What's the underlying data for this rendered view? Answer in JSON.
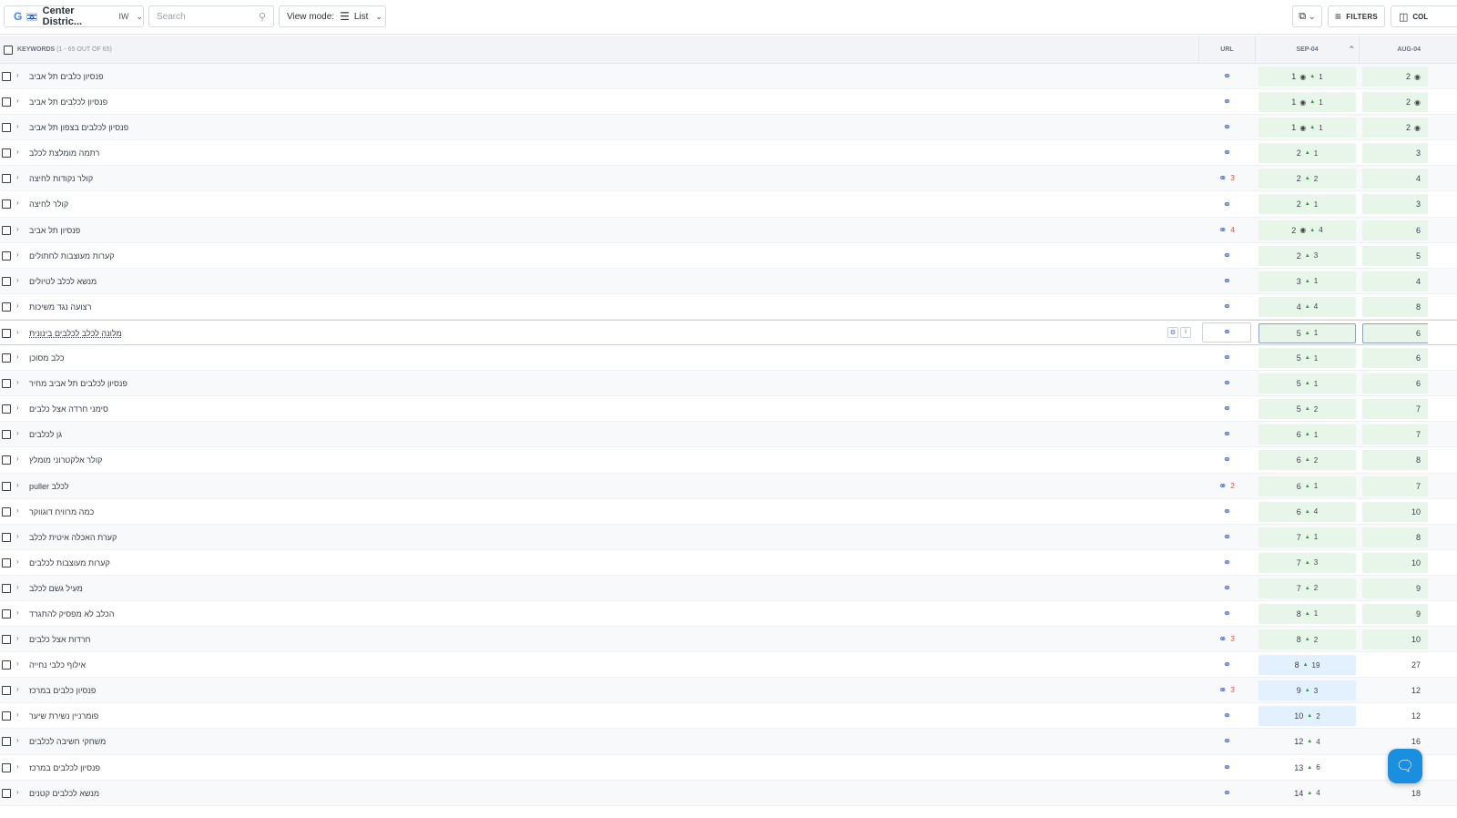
{
  "toolbar": {
    "location": {
      "engine_icon": "google-icon",
      "flag_icon": "israel-flag-icon",
      "name": "Center Distric...",
      "lang": "IW"
    },
    "search_placeholder": "Search",
    "view_mode": {
      "label": "View mode:",
      "value": "List",
      "icon": "list-icon"
    },
    "copy_icon": "copy-icon",
    "filters_label": "FILTERS",
    "columns_label": "COL"
  },
  "table": {
    "header": {
      "keywords": "KEYWORDS",
      "count": "(1 - 65 OUT OF 65)",
      "url": "URL",
      "col1": "SEP-04",
      "col2": "AUG-04"
    },
    "colors": {
      "green": "#e8f6ea",
      "blue": "#e2f1fd",
      "link": "#3f6ad8",
      "up": "#2f9a46",
      "url_count": "#e05050"
    },
    "rows": [
      {
        "kw": "פנסיון כלבים תל אביב",
        "urls": "",
        "pos": "1",
        "pin": true,
        "delta": "1",
        "prev": "2",
        "prev_pin": true,
        "style": "green"
      },
      {
        "kw": "פנסיון לכלבים תל אביב",
        "urls": "",
        "pos": "1",
        "pin": true,
        "delta": "1",
        "prev": "2",
        "prev_pin": true,
        "style": "green"
      },
      {
        "kw": "פנסיון לכלבים בצפון תל אביב",
        "urls": "",
        "pos": "1",
        "pin": true,
        "delta": "1",
        "prev": "2",
        "prev_pin": true,
        "style": "green"
      },
      {
        "kw": "רתמה מומלצת לכלב",
        "urls": "",
        "pos": "2",
        "pin": false,
        "delta": "1",
        "prev": "3",
        "prev_pin": false,
        "style": "green"
      },
      {
        "kw": "קולר נקודות לחיצה",
        "urls": "3",
        "pos": "2",
        "pin": false,
        "delta": "2",
        "prev": "4",
        "prev_pin": false,
        "style": "green"
      },
      {
        "kw": "קולר לחיצה",
        "urls": "",
        "pos": "2",
        "pin": false,
        "delta": "1",
        "prev": "3",
        "prev_pin": false,
        "style": "green"
      },
      {
        "kw": "פנסיון תל אביב",
        "urls": "4",
        "pos": "2",
        "pin": true,
        "delta": "4",
        "prev": "6",
        "prev_pin": false,
        "style": "green"
      },
      {
        "kw": "קערות מעוצבות לחתולים",
        "urls": "",
        "pos": "2",
        "pin": false,
        "delta": "3",
        "prev": "5",
        "prev_pin": false,
        "style": "green"
      },
      {
        "kw": "מנשא לכלב לטיולים",
        "urls": "",
        "pos": "3",
        "pin": false,
        "delta": "1",
        "prev": "4",
        "prev_pin": false,
        "style": "green"
      },
      {
        "kw": "רצועה נגד משיכות",
        "urls": "",
        "pos": "4",
        "pin": false,
        "delta": "4",
        "prev": "8",
        "prev_pin": false,
        "style": "green"
      },
      {
        "kw": "מלונה לכלב לכלבים בינונית",
        "urls": "",
        "pos": "5",
        "pin": false,
        "delta": "1",
        "prev": "6",
        "prev_pin": false,
        "style": "green",
        "selected": true
      },
      {
        "kw": "כלב מסוכן",
        "urls": "",
        "pos": "5",
        "pin": false,
        "delta": "1",
        "prev": "6",
        "prev_pin": false,
        "style": "green"
      },
      {
        "kw": "פנסיון לכלבים תל אביב מחיר",
        "urls": "",
        "pos": "5",
        "pin": false,
        "delta": "1",
        "prev": "6",
        "prev_pin": false,
        "style": "green"
      },
      {
        "kw": "סימני חרדה אצל כלבים",
        "urls": "",
        "pos": "5",
        "pin": false,
        "delta": "2",
        "prev": "7",
        "prev_pin": false,
        "style": "green"
      },
      {
        "kw": "גן לכלבים",
        "urls": "",
        "pos": "6",
        "pin": false,
        "delta": "1",
        "prev": "7",
        "prev_pin": false,
        "style": "green"
      },
      {
        "kw": "קולר אלקטרוני מומלץ",
        "urls": "",
        "pos": "6",
        "pin": false,
        "delta": "2",
        "prev": "8",
        "prev_pin": false,
        "style": "green"
      },
      {
        "kw": "puller לכלב",
        "urls": "2",
        "pos": "6",
        "pin": false,
        "delta": "1",
        "prev": "7",
        "prev_pin": false,
        "style": "green"
      },
      {
        "kw": "כמה מרוויח דוגווקר",
        "urls": "",
        "pos": "6",
        "pin": false,
        "delta": "4",
        "prev": "10",
        "prev_pin": false,
        "style": "green"
      },
      {
        "kw": "קערת האכלה איטית לכלב",
        "urls": "",
        "pos": "7",
        "pin": false,
        "delta": "1",
        "prev": "8",
        "prev_pin": false,
        "style": "green"
      },
      {
        "kw": "קערות מעוצבות לכלבים",
        "urls": "",
        "pos": "7",
        "pin": false,
        "delta": "3",
        "prev": "10",
        "prev_pin": false,
        "style": "green"
      },
      {
        "kw": "מעיל גשם לכלב",
        "urls": "",
        "pos": "7",
        "pin": false,
        "delta": "2",
        "prev": "9",
        "prev_pin": false,
        "style": "green"
      },
      {
        "kw": "הכלב לא מפסיק להתגרד",
        "urls": "",
        "pos": "8",
        "pin": false,
        "delta": "1",
        "prev": "9",
        "prev_pin": false,
        "style": "green"
      },
      {
        "kw": "חרדות אצל כלבים",
        "urls": "3",
        "pos": "8",
        "pin": false,
        "delta": "2",
        "prev": "10",
        "prev_pin": false,
        "style": "green"
      },
      {
        "kw": "אילוף כלבי נחייה",
        "urls": "",
        "pos": "8",
        "pin": false,
        "delta": "19",
        "prev": "27",
        "prev_pin": false,
        "style": "blue"
      },
      {
        "kw": "פנסיון כלבים במרכז",
        "urls": "3",
        "pos": "9",
        "pin": false,
        "delta": "3",
        "prev": "12",
        "prev_pin": false,
        "style": "blue"
      },
      {
        "kw": "פומרניין נשירת שיער",
        "urls": "",
        "pos": "10",
        "pin": false,
        "delta": "2",
        "prev": "12",
        "prev_pin": false,
        "style": "blue"
      },
      {
        "kw": "משחקי חשיבה לכלבים",
        "urls": "",
        "pos": "12",
        "pin": false,
        "delta": "4",
        "prev": "16",
        "prev_pin": false,
        "style": "none"
      },
      {
        "kw": "פנסיון לכלבים במרכז",
        "urls": "",
        "pos": "13",
        "pin": false,
        "delta": "6",
        "prev": "19",
        "prev_pin": false,
        "style": "none"
      },
      {
        "kw": "מנשא לכלבים קטנים",
        "urls": "",
        "pos": "14",
        "pin": false,
        "delta": "4",
        "prev": "18",
        "prev_pin": false,
        "style": "none"
      }
    ]
  },
  "chat_icon": "chat-icon"
}
